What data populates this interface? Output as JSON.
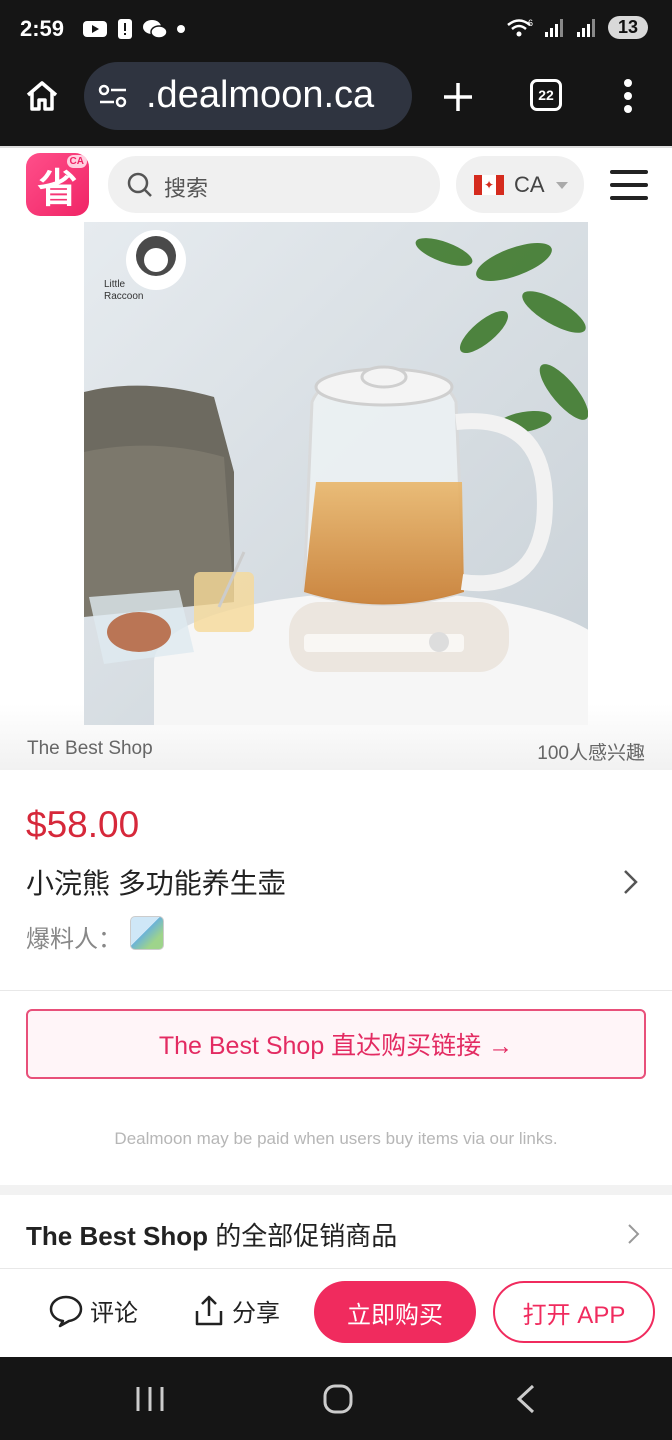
{
  "status": {
    "time": "2:59",
    "network": "6",
    "battery": "13"
  },
  "browser": {
    "url": ".dealmoon.ca",
    "tab_count": "22"
  },
  "site_header": {
    "logo_text": "省",
    "logo_badge": "CA",
    "search_placeholder": "搜索",
    "region": "CA"
  },
  "product": {
    "image_logo_text": [
      "Little",
      "Raccoon"
    ],
    "shop_name": "The Best Shop",
    "interest": "100人感兴趣",
    "price": "$58.00",
    "title": "小浣熊 多功能养生壶",
    "poster_label": "爆料人："
  },
  "buy_link": {
    "label": "The Best Shop 直达购买链接 →"
  },
  "disclaimer": "Dealmoon may be paid when users buy items via our links.",
  "all_deals": {
    "shop": "The Best Shop",
    "suffix": " 的全部促销商品"
  },
  "action_bar": {
    "comment": "评论",
    "share": "分享",
    "buy_now": "立即购买",
    "open_app": "打开 APP"
  },
  "colors": {
    "accent": "#f02b5e",
    "price": "#d6283a",
    "system_bar": "#151515"
  }
}
